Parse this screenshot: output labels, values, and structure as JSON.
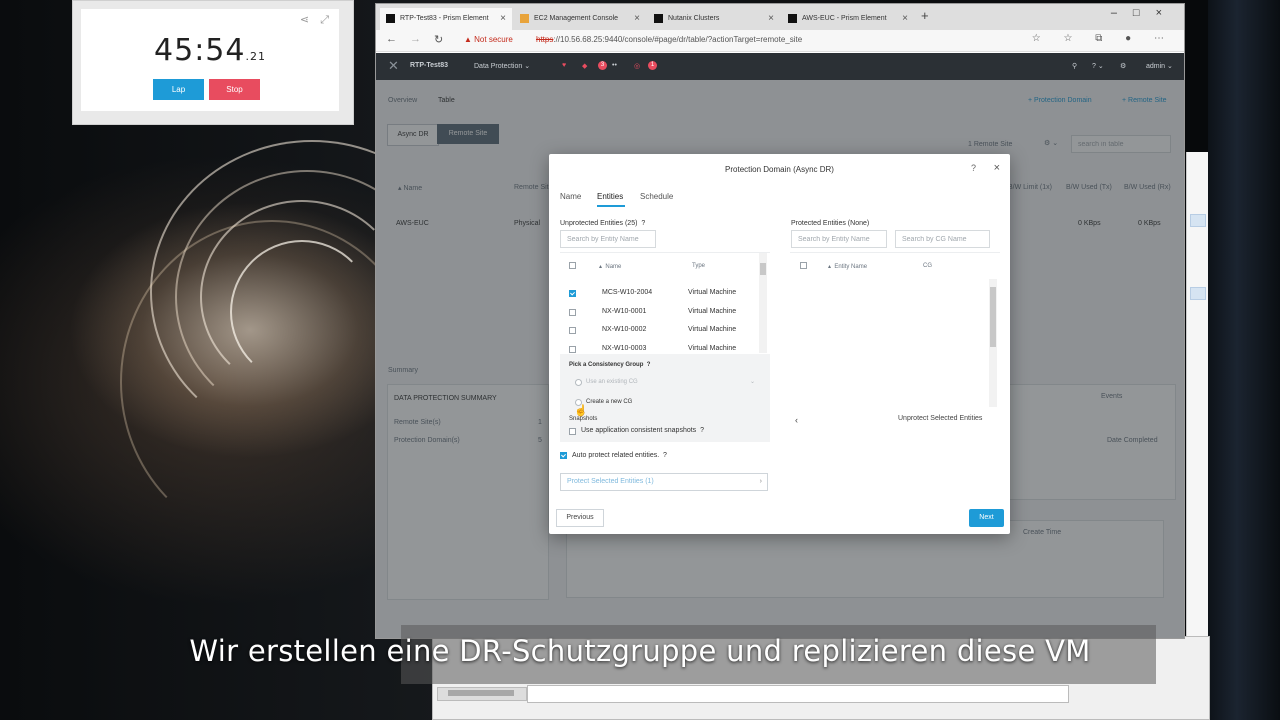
{
  "stopwatch": {
    "time": "45:54",
    "fraction": ".21",
    "lap_label": "Lap",
    "stop_label": "Stop"
  },
  "browser": {
    "tabs": [
      {
        "label": "RTP-Test83 - Prism Element",
        "active": true
      },
      {
        "label": "EC2 Management Console",
        "active": false
      },
      {
        "label": "Nutanix Clusters",
        "active": false
      },
      {
        "label": "AWS-EUC - Prism Element",
        "active": false
      }
    ],
    "address": {
      "warning": "Not secure",
      "scheme": "https",
      "url_rest": "://10.56.68.25:9440/console/#page/dr/table/?actionTarget=remote_site"
    }
  },
  "app": {
    "cluster_name": "RTP-Test83",
    "menu": "Data Protection",
    "alerts_red": "3",
    "alerts_count": "1",
    "user": "admin",
    "breadcrumb": {
      "overview": "Overview",
      "table": "Table"
    },
    "actions": {
      "protection_domain": "+ Protection Domain",
      "remote_site": "+ Remote Site"
    },
    "view_buttons": [
      "Async DR",
      "Remote Site"
    ],
    "remote_site_count": "1 Remote Site",
    "search_table_placeholder": "search in table",
    "table_headers": [
      "Name",
      "Remote Site",
      "B/W Limit (1x)",
      "B/W Used (Tx)",
      "B/W Used (Rx)"
    ],
    "row": {
      "name": "AWS-EUC",
      "type": "Physical",
      "tx": "0 KBps",
      "rx": "0 KBps"
    },
    "summary_title": "Summary",
    "summary": {
      "title": "DATA PROTECTION SUMMARY",
      "rows": [
        {
          "label": "Remote Site(s)",
          "value": "1"
        },
        {
          "label": "Protection Domain(s)",
          "value": "5"
        }
      ],
      "events": "Events",
      "date_completed": "Date Completed",
      "create_time": "Create Time"
    }
  },
  "modal": {
    "title": "Protection Domain (Async DR)",
    "help": "?",
    "tabs": [
      "Name",
      "Entities",
      "Schedule"
    ],
    "unprotected_label": "Unprotected Entities (25)",
    "protected_label": "Protected Entities (None)",
    "search_entity_placeholder": "Search by Entity Name",
    "search_cg_placeholder": "Search by CG Name",
    "left_headers": {
      "name": "Name",
      "type": "Type"
    },
    "right_headers": {
      "name": "Entity Name",
      "cg": "CG"
    },
    "entities": [
      {
        "name": "MCS-W10-2004",
        "type": "Virtual Machine",
        "checked": true
      },
      {
        "name": "NX-W10-0001",
        "type": "Virtual Machine",
        "checked": false
      },
      {
        "name": "NX-W10-0002",
        "type": "Virtual Machine",
        "checked": false
      },
      {
        "name": "NX-W10-0003",
        "type": "Virtual Machine",
        "checked": false
      }
    ],
    "consistency_group": {
      "title": "Pick a Consistency Group",
      "existing": "Use an existing CG",
      "create_new": "Create a new CG",
      "snapshots_title": "Snapshots",
      "app_consistent": "Use application consistent snapshots"
    },
    "auto_protect": "Auto protect related entities.",
    "protect_button": "Protect Selected Entities (1)",
    "unprotect_button": "Unprotect Selected Entities",
    "previous": "Previous",
    "next": "Next"
  },
  "caption": "Wir erstellen eine DR-Schutzgruppe und replizieren diese VM"
}
